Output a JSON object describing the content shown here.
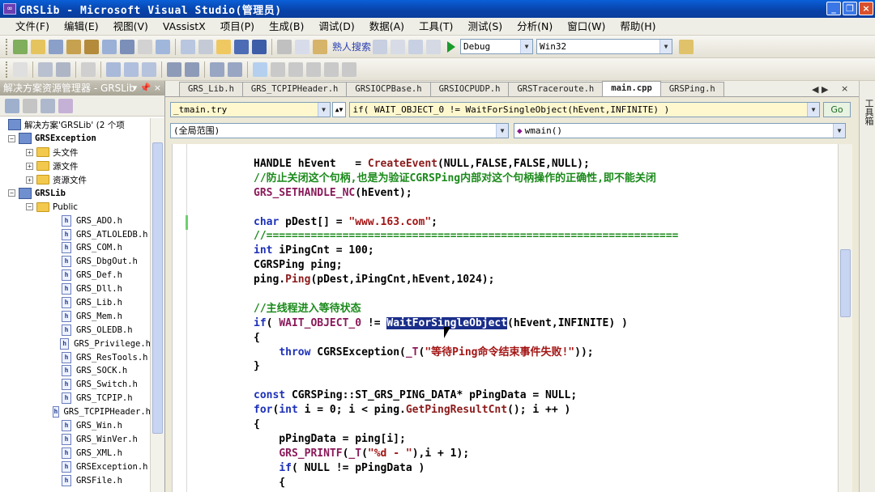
{
  "window": {
    "title": "GRSLib - Microsoft Visual Studio(管理员)"
  },
  "menu": [
    "文件(F)",
    "编辑(E)",
    "视图(V)",
    "VAssistX",
    "项目(P)",
    "生成(B)",
    "调试(D)",
    "数据(A)",
    "工具(T)",
    "测试(S)",
    "分析(N)",
    "窗口(W)",
    "帮助(H)"
  ],
  "toolbar": {
    "search_label": "熟人搜索",
    "config": "Debug",
    "platform": "Win32"
  },
  "solution_explorer": {
    "title": "解决方案资源管理器 - GRSLib",
    "items": [
      {
        "label": "解决方案'GRSLib' (2 个项",
        "indent": 0,
        "kind": "solution"
      },
      {
        "label": "GRSException",
        "indent": 0,
        "kind": "project",
        "exp": "−"
      },
      {
        "label": "头文件",
        "indent": 1,
        "kind": "folder",
        "exp": "+"
      },
      {
        "label": "源文件",
        "indent": 1,
        "kind": "folder",
        "exp": "+"
      },
      {
        "label": "资源文件",
        "indent": 1,
        "kind": "folder",
        "exp": "+"
      },
      {
        "label": "GRSLib",
        "indent": 0,
        "kind": "project",
        "exp": "−"
      },
      {
        "label": "Public",
        "indent": 1,
        "kind": "folder",
        "exp": "−"
      },
      {
        "label": "GRS_ADO.h",
        "indent": 2,
        "kind": "file"
      },
      {
        "label": "GRS_ATLOLEDB.h",
        "indent": 2,
        "kind": "file"
      },
      {
        "label": "GRS_COM.h",
        "indent": 2,
        "kind": "file"
      },
      {
        "label": "GRS_DbgOut.h",
        "indent": 2,
        "kind": "file"
      },
      {
        "label": "GRS_Def.h",
        "indent": 2,
        "kind": "file"
      },
      {
        "label": "GRS_Dll.h",
        "indent": 2,
        "kind": "file"
      },
      {
        "label": "GRS_Lib.h",
        "indent": 2,
        "kind": "file"
      },
      {
        "label": "GRS_Mem.h",
        "indent": 2,
        "kind": "file"
      },
      {
        "label": "GRS_OLEDB.h",
        "indent": 2,
        "kind": "file"
      },
      {
        "label": "GRS_Privilege.h",
        "indent": 2,
        "kind": "file"
      },
      {
        "label": "GRS_ResTools.h",
        "indent": 2,
        "kind": "file"
      },
      {
        "label": "GRS_SOCK.h",
        "indent": 2,
        "kind": "file"
      },
      {
        "label": "GRS_Switch.h",
        "indent": 2,
        "kind": "file"
      },
      {
        "label": "GRS_TCPIP.h",
        "indent": 2,
        "kind": "file"
      },
      {
        "label": "GRS_TCPIPHeader.h",
        "indent": 2,
        "kind": "file"
      },
      {
        "label": "GRS_Win.h",
        "indent": 2,
        "kind": "file"
      },
      {
        "label": "GRS_WinVer.h",
        "indent": 2,
        "kind": "file"
      },
      {
        "label": "GRS_XML.h",
        "indent": 2,
        "kind": "file"
      },
      {
        "label": "GRSException.h",
        "indent": 2,
        "kind": "file"
      },
      {
        "label": "GRSFile.h",
        "indent": 2,
        "kind": "file"
      }
    ]
  },
  "tabs": [
    {
      "label": "GRS_Lib.h",
      "active": false
    },
    {
      "label": "GRS_TCPIPHeader.h",
      "active": false
    },
    {
      "label": "GRSIOCPBase.h",
      "active": false
    },
    {
      "label": "GRSIOCPUDP.h",
      "active": false
    },
    {
      "label": "GRSTraceroute.h",
      "active": false
    },
    {
      "label": "main.cpp",
      "active": true
    },
    {
      "label": "GRSPing.h",
      "active": false
    }
  ],
  "nav": {
    "scope_left": "_tmain.try",
    "scope_right": "if( WAIT_OBJECT_0 != WaitForSingleObject(hEvent,INFINITE) )",
    "go_label": "Go",
    "global_scope": "(全局范围)",
    "function": "wmain()"
  },
  "code_lines": [
    [
      [
        "HANDLE hEvent   = ",
        ""
      ],
      [
        "CreateEvent",
        "fn"
      ],
      [
        "(NULL,FALSE,FALSE,NULL);",
        ""
      ]
    ],
    [
      [
        "//防止关闭这个句柄,也是为验证CGRSPing内部对这个句柄操作的正确性,即不能关闭",
        "cm"
      ]
    ],
    [
      [
        "GRS_SETHANDLE_NC",
        "mac"
      ],
      [
        "(hEvent);",
        ""
      ]
    ],
    [
      [
        "",
        ""
      ]
    ],
    [
      [
        "char",
        "kw"
      ],
      [
        " pDest[] = ",
        ""
      ],
      [
        "\"www.163.com\"",
        "str"
      ],
      [
        ";",
        ""
      ]
    ],
    [
      [
        "//=================================================================",
        "cm"
      ]
    ],
    [
      [
        "int",
        "kw"
      ],
      [
        " iPingCnt = 100;",
        ""
      ]
    ],
    [
      [
        "CGRSPing ping;",
        ""
      ]
    ],
    [
      [
        "ping.",
        ""
      ],
      [
        "Ping",
        "fn"
      ],
      [
        "(pDest,iPingCnt,hEvent,1024);",
        ""
      ]
    ],
    [
      [
        "",
        ""
      ]
    ],
    [
      [
        "//主线程进入等待状态",
        "cm"
      ]
    ],
    [
      [
        "if",
        "kw"
      ],
      [
        "( ",
        ""
      ],
      [
        "WAIT_OBJECT_0",
        "mac"
      ],
      [
        " != ",
        ""
      ],
      [
        "WaitForSingleObject",
        "sel"
      ],
      [
        "(hEvent,INFINITE) )",
        ""
      ]
    ],
    [
      [
        "{",
        ""
      ]
    ],
    [
      [
        "    ",
        ""
      ],
      [
        "throw",
        "kw"
      ],
      [
        " CGRSException(",
        ""
      ],
      [
        "_T",
        "mac"
      ],
      [
        "(",
        ""
      ],
      [
        "\"等待Ping命令结束事件失败!\"",
        "str"
      ],
      [
        "));",
        ""
      ]
    ],
    [
      [
        "}",
        ""
      ]
    ],
    [
      [
        "",
        ""
      ]
    ],
    [
      [
        "const",
        "kw"
      ],
      [
        " CGRSPing::ST_GRS_PING_DATA* pPingData = NULL;",
        ""
      ]
    ],
    [
      [
        "for",
        "kw"
      ],
      [
        "(",
        ""
      ],
      [
        "int",
        "kw"
      ],
      [
        " i = 0; i < ping.",
        ""
      ],
      [
        "GetPingResultCnt",
        "fn"
      ],
      [
        "(); i ++ )",
        ""
      ]
    ],
    [
      [
        "{",
        ""
      ]
    ],
    [
      [
        "    pPingData = ping[i];",
        ""
      ]
    ],
    [
      [
        "    ",
        ""
      ],
      [
        "GRS_PRINTF",
        "mac"
      ],
      [
        "(",
        ""
      ],
      [
        "_T",
        "mac"
      ],
      [
        "(",
        ""
      ],
      [
        "\"%d - \"",
        "str"
      ],
      [
        "),i + 1);",
        ""
      ]
    ],
    [
      [
        "    ",
        ""
      ],
      [
        "if",
        "kw"
      ],
      [
        "( NULL != pPingData )",
        ""
      ]
    ],
    [
      [
        "    {",
        ""
      ]
    ]
  ],
  "colors": {
    "titlebar": "#0842a8",
    "keyword": "#1d31b8",
    "comment": "#1a8a1a",
    "string": "#a31515",
    "selection": "#1a2e8a"
  },
  "right_strip": "工具箱"
}
